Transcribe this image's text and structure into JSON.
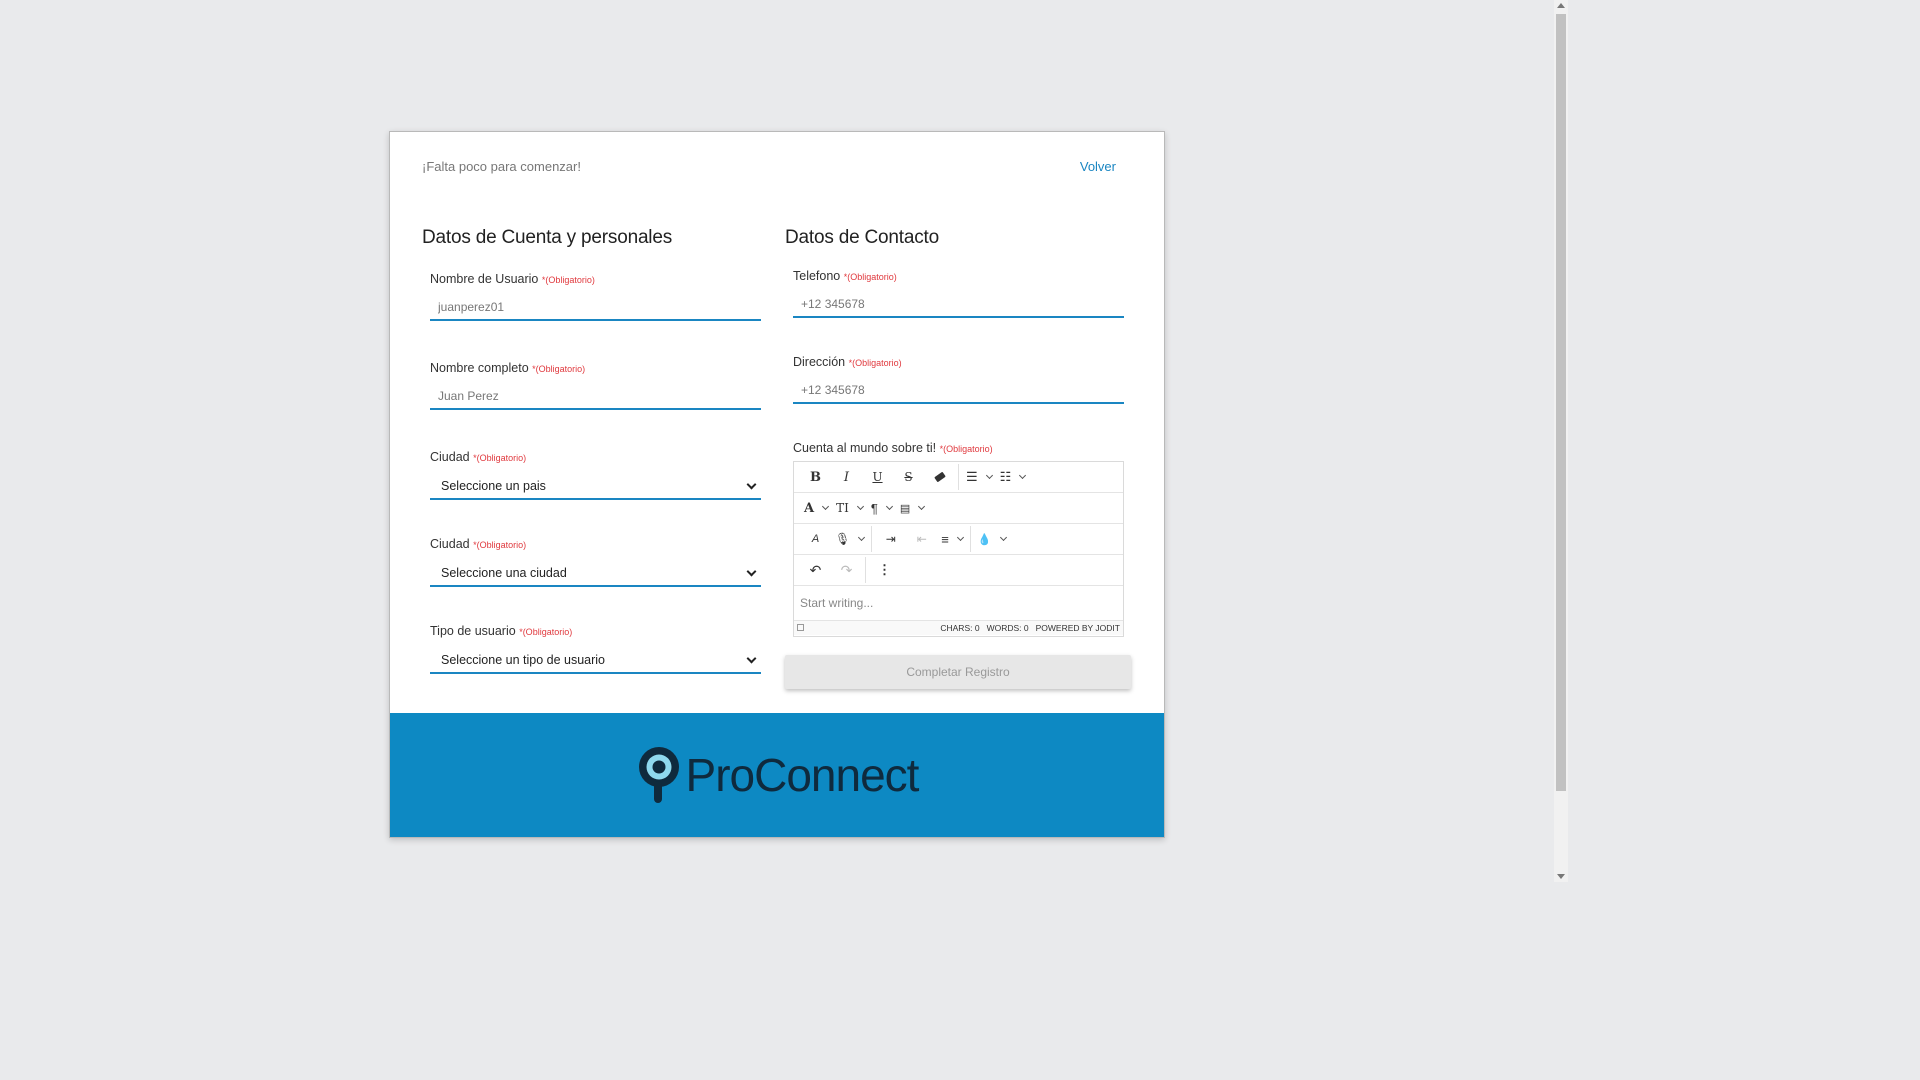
{
  "header": {
    "subtitle": "¡Falta poco para comenzar!",
    "back_label": "Volver"
  },
  "left": {
    "title": "Datos de Cuenta y personales",
    "required_label": "*(Obligatorio)",
    "username": {
      "label": "Nombre de Usuario",
      "placeholder": "juanperez01"
    },
    "fullname": {
      "label": "Nombre completo",
      "placeholder": "Juan Perez"
    },
    "country": {
      "label": "Ciudad",
      "value": "Seleccione un pais"
    },
    "city": {
      "label": "Ciudad",
      "value": "Seleccione una ciudad"
    },
    "usertype": {
      "label": "Tipo de usuario",
      "value": "Seleccione un tipo de usuario"
    }
  },
  "right": {
    "title": "Datos de Contacto",
    "required_label": "*(Obligatorio)",
    "phone": {
      "label": "Telefono",
      "placeholder": "+12 345678"
    },
    "address": {
      "label": "Dirección",
      "placeholder": "+12 345678"
    },
    "about": {
      "label": "Cuenta al mundo sobre ti!"
    },
    "editor": {
      "placeholder": "Start writing...",
      "chars": "CHARS: 0",
      "words": "WORDS: 0",
      "powered": "POWERED BY JODIT"
    },
    "submit_label": "Completar Registro"
  },
  "footer": {
    "brand": "ProConnect",
    "colors": {
      "background": "#0d89c3",
      "brand_text": "#0f2a3d",
      "accent": "#1a86c2",
      "required": "#e0393e"
    }
  }
}
